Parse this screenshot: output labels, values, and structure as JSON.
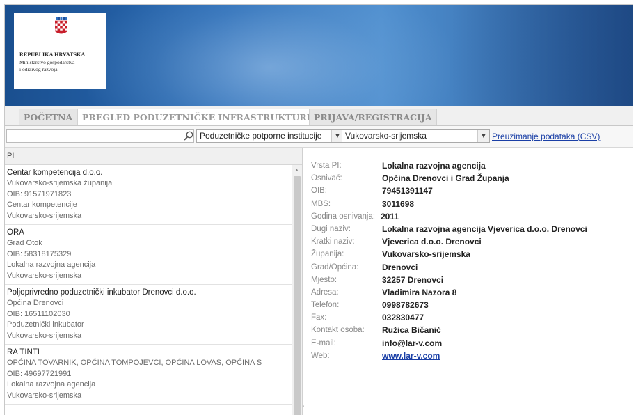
{
  "logo": {
    "line1": "REPUBLIKA HRVATSKA",
    "line2": "Ministarstvo gospodarstva",
    "line3": "i održivog razvoja"
  },
  "tabs": [
    {
      "label": "POČETNA"
    },
    {
      "label": "PREGLED PODUZETNIČKE INFRASTRUKTURE"
    },
    {
      "label": "PRIJAVA/REGISTRACIJA"
    }
  ],
  "toolbar": {
    "search_value": "",
    "category_select": "Poduzetničke potporne institucije",
    "county_select": "Vukovarsko-srijemska",
    "csv_link": "Preuzimanje podataka (CSV)"
  },
  "list": {
    "header": "PI",
    "items": [
      {
        "title": "Centar kompetencija d.o.o.",
        "lines": [
          "Vukovarsko-srijemska županija",
          "OIB: 91571971823",
          "Centar kompetencije",
          "Vukovarsko-srijemska"
        ]
      },
      {
        "title": "ORA",
        "lines": [
          "Grad Otok",
          "OIB: 58318175329",
          "Lokalna razvojna agencija",
          "Vukovarsko-srijemska"
        ]
      },
      {
        "title": "Poljoprivredno poduzetnički inkubator Drenovci d.o.o.",
        "lines": [
          "Općina Drenovci",
          "OIB: 16511102030",
          "Poduzetnički inkubator",
          "Vukovarsko-srijemska"
        ]
      },
      {
        "title": "RA TINTL",
        "lines": [
          "OPĆINA TOVARNIK, OPĆINA TOMPOJEVCI, OPĆINA LOVAS, OPĆINA S",
          "OIB: 49697721991",
          "Lokalna razvojna agencija",
          "Vukovarsko-srijemska"
        ]
      }
    ]
  },
  "details": [
    {
      "label": "Vrsta PI:",
      "value": "Lokalna razvojna agencija"
    },
    {
      "label": "Osnivač:",
      "value": "Općina Drenovci i Grad Županja"
    },
    {
      "label": "OIB:",
      "value": "79451391147"
    },
    {
      "label": "MBS:",
      "value": "3011698"
    },
    {
      "label": "Godina osnivanja:",
      "value": "2011"
    },
    {
      "label": "Dugi naziv:",
      "value": "Lokalna razvojna agencija Vjeverica d.o.o. Drenovci"
    },
    {
      "label": "Kratki naziv:",
      "value": "Vjeverica d.o.o. Drenovci"
    },
    {
      "label": "Županija:",
      "value": "Vukovarsko-srijemska"
    },
    {
      "label": "Grad/Općina:",
      "value": "Drenovci"
    },
    {
      "label": "Mjesto:",
      "value": "32257 Drenovci"
    },
    {
      "label": "Adresa:",
      "value": "Vladimira Nazora 8"
    },
    {
      "label": "Telefon:",
      "value": "0998782673"
    },
    {
      "label": "Fax:",
      "value": "032830477"
    },
    {
      "label": "Kontakt osoba:",
      "value": "Ružica Bičanić"
    },
    {
      "label": "E-mail:",
      "value": "info@lar-v.com"
    },
    {
      "label": "Web:",
      "value": "www.lar-v.com"
    }
  ],
  "colors": {
    "header_blue": "#2a6bb5",
    "link": "#1a3fa6"
  }
}
